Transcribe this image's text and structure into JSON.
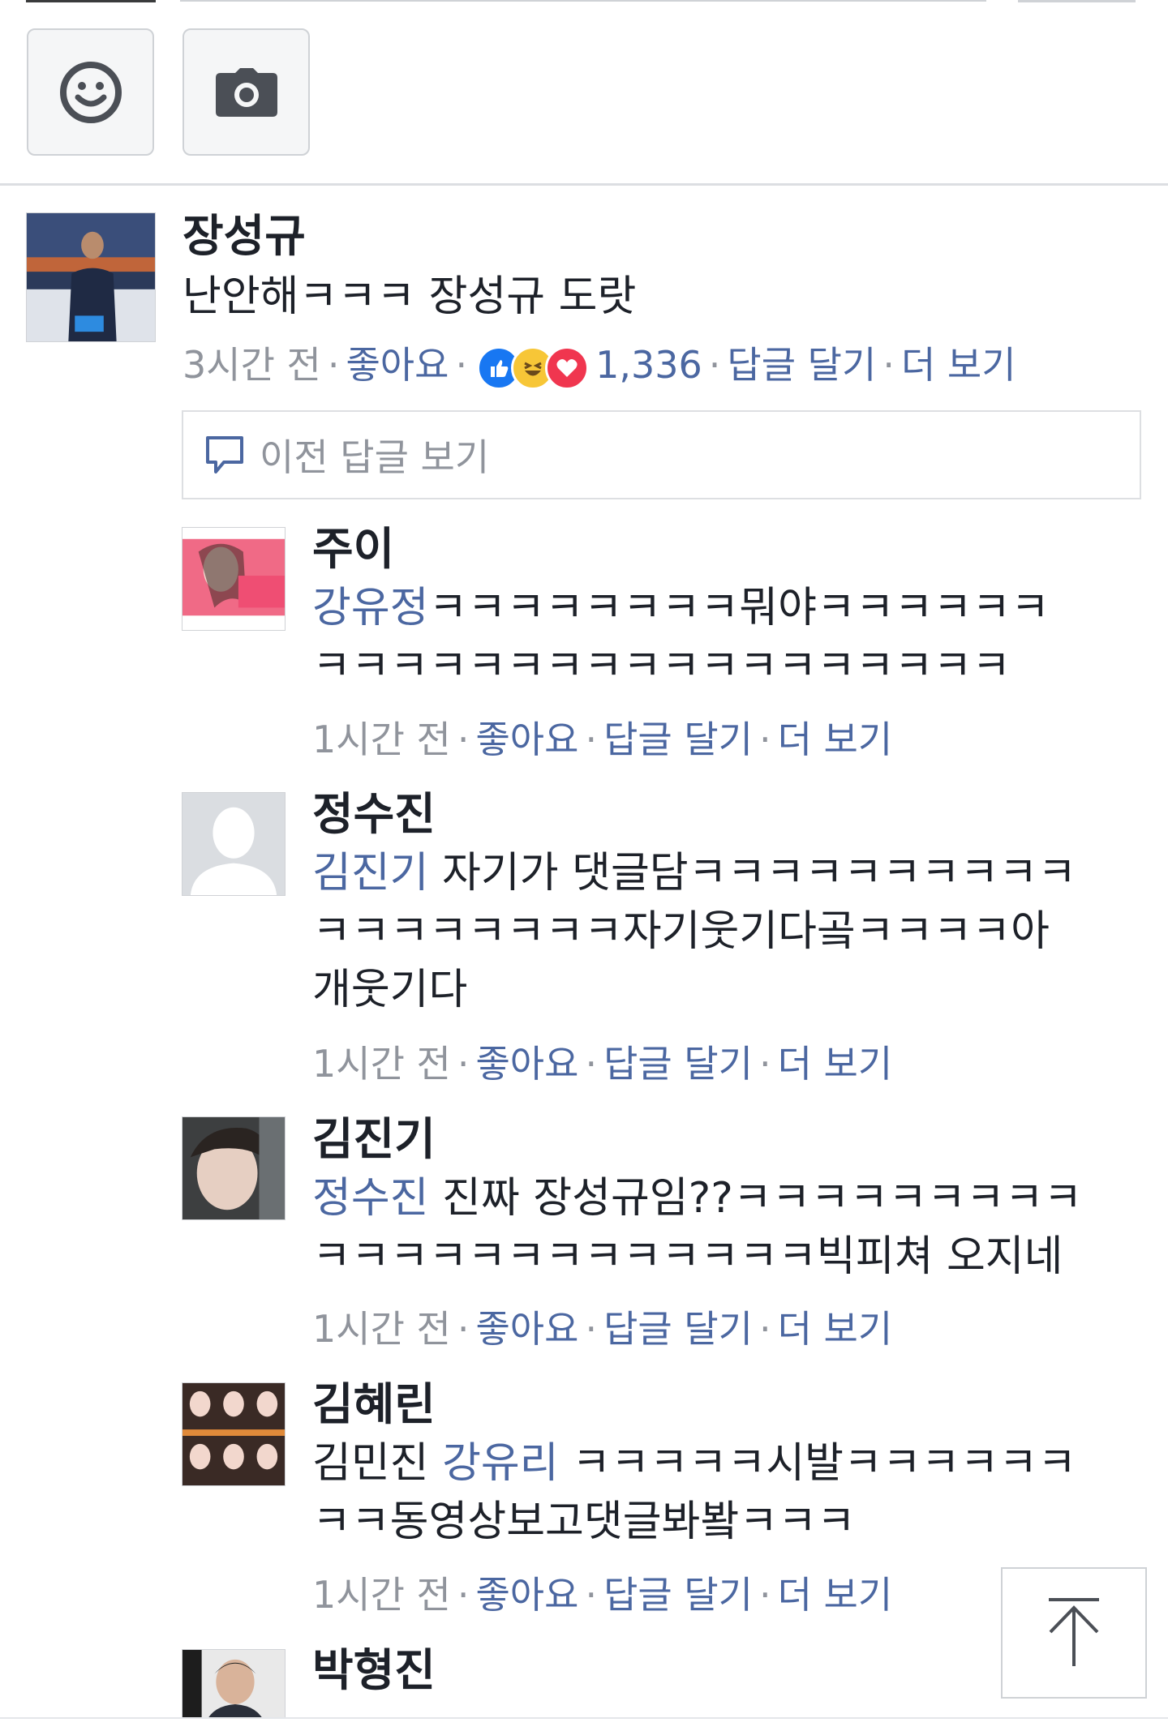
{
  "composer": {
    "emoji_button": "emoji",
    "camera_button": "camera"
  },
  "main_comment": {
    "author": "장성규",
    "text": "난안해ㅋㅋㅋ 장성규 도랏",
    "time": "3시간 전",
    "like": "좋아요",
    "reaction_count": "1,336",
    "reply": "답글 달기",
    "more": "더 보기",
    "reactions": [
      "like-icon",
      "haha-icon",
      "love-icon"
    ]
  },
  "previous_replies_label": "이전 답글 보기",
  "replies": [
    {
      "author": "주이",
      "mention": "강유정",
      "line1_rest": "ㅋㅋㅋㅋㅋㅋㅋㅋ뭐야ㅋㅋㅋㅋㅋㅋ",
      "line2": "ㅋㅋㅋㅋㅋㅋㅋㅋㅋㅋㅋㅋㅋㅋㅋㅋㅋㅋ",
      "time": "1시간 전",
      "like": "좋아요",
      "reply": "답글 달기",
      "more": "더 보기"
    },
    {
      "author": "정수진",
      "mention": "김진기",
      "line1_rest": " 자기가 댓글담ㅋㅋㅋㅋㅋㅋㅋㅋㅋㅋ",
      "line2": "ㅋㅋㅋㅋㅋㅋㅋㅋ자기웃기다곸ㅋㅋㅋㅋ아",
      "line3": "개웃기다",
      "time": "1시간 전",
      "like": "좋아요",
      "reply": "답글 달기",
      "more": "더 보기"
    },
    {
      "author": "김진기",
      "mention": "정수진",
      "line1_rest": " 진짜 장성규임??ㅋㅋㅋㅋㅋㅋㅋㅋㅋ",
      "line2": "ㅋㅋㅋㅋㅋㅋㅋㅋㅋㅋㅋㅋㅋ빅피쳐 오지네",
      "time": "1시간 전",
      "like": "좋아요",
      "reply": "답글 달기",
      "more": "더 보기"
    },
    {
      "author": "김혜린",
      "plain_prefix": "김민진 ",
      "mention": "강유리",
      "line1_rest": " ㅋㅋㅋㅋㅋ시발ㅋㅋㅋㅋㅋㅋ",
      "line2": "ㅋㅋ동영상보고댓글봐봨ㅋㅋㅋ",
      "time": "1시간 전",
      "like": "좋아요",
      "reply": "답글 달기",
      "more": "더 보기"
    },
    {
      "author": "박형진"
    }
  ],
  "colors": {
    "link": "#4b67a1",
    "meta": "#90949c",
    "text": "#1d2129"
  }
}
